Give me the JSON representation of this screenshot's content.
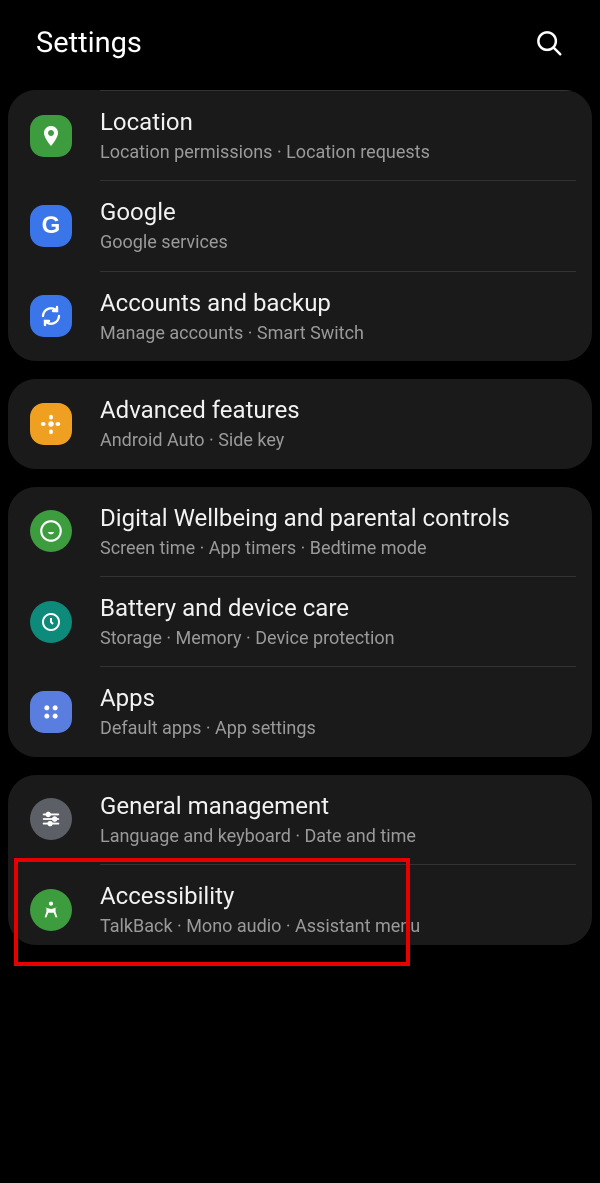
{
  "header": {
    "title": "Settings"
  },
  "groups": [
    {
      "items": [
        {
          "key": "location",
          "title": "Location",
          "subtitle": "Location permissions  ·  Location requests"
        },
        {
          "key": "google",
          "title": "Google",
          "subtitle": "Google services"
        },
        {
          "key": "accounts",
          "title": "Accounts and backup",
          "subtitle": "Manage accounts  ·  Smart Switch"
        }
      ]
    },
    {
      "items": [
        {
          "key": "advanced",
          "title": "Advanced features",
          "subtitle": "Android Auto  ·  Side key"
        }
      ]
    },
    {
      "items": [
        {
          "key": "wellbeing",
          "title": "Digital Wellbeing and parental controls",
          "subtitle": "Screen time  ·  App timers  ·  Bedtime mode"
        },
        {
          "key": "battery",
          "title": "Battery and device care",
          "subtitle": "Storage  ·  Memory  ·  Device protection"
        },
        {
          "key": "apps",
          "title": "Apps",
          "subtitle": "Default apps  ·  App settings"
        }
      ]
    },
    {
      "items": [
        {
          "key": "general",
          "title": "General management",
          "subtitle": "Language and keyboard  ·  Date and time"
        },
        {
          "key": "accessibility",
          "title": "Accessibility",
          "subtitle": "TalkBack  ·  Mono audio  ·  Assistant menu"
        }
      ]
    }
  ]
}
